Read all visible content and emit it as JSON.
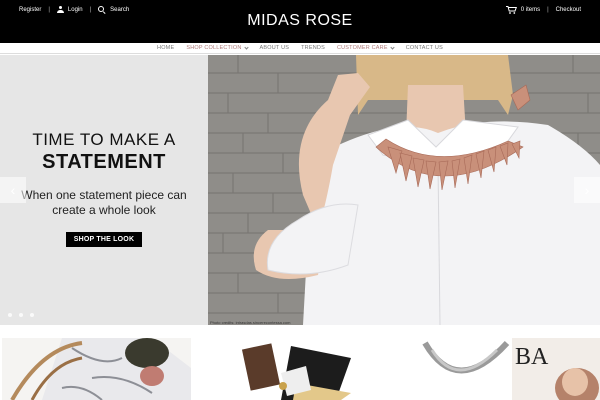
{
  "topbar": {
    "register": "Register",
    "login": "Login",
    "search": "Search",
    "cart": "0 items",
    "checkout": "Checkout"
  },
  "brand": {
    "name": "MIDAS ROSE"
  },
  "nav": {
    "home": "HOME",
    "shop": "SHOP COLLECTION",
    "about": "ABOUT US",
    "trends": "TRENDS",
    "care": "CUSTOMER CARE",
    "contact": "CONTACT US"
  },
  "hero": {
    "line1": "TIME TO MAKE A",
    "line2": "STATEMENT",
    "subtitle": "When one statement piece can create a whole look",
    "button": "SHOP THE LOOK",
    "credit": "Photo credits: intrasdas.sincerecontessa.com",
    "prev": "‹",
    "next": "›"
  },
  "colors": {
    "topbar": "#000000",
    "accent": "#b07a7a",
    "hero_bg": "#e6e6e6"
  },
  "icons": [
    "user-icon",
    "search-icon",
    "cart-icon",
    "chevron-left-icon",
    "chevron-right-icon"
  ]
}
